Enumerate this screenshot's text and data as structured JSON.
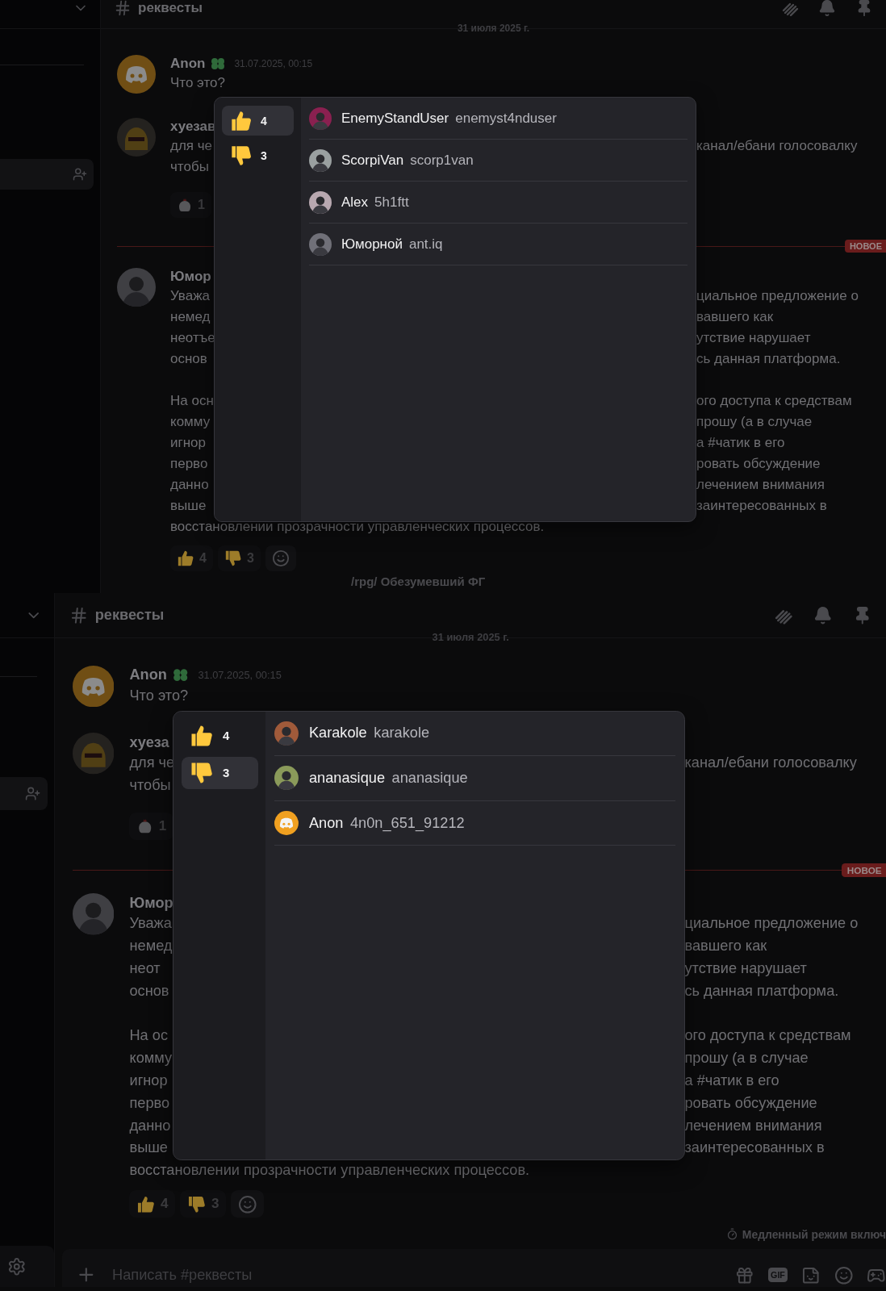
{
  "screens": [
    {
      "channel": "реквесты",
      "date_divider": "31 июля 2025 г.",
      "messages": [
        {
          "kind": "message",
          "author": "Anon",
          "badge": {
            "kind": "clover"
          },
          "timestamp": "31.07.2025, 00:15",
          "avatar": {
            "kind": "default"
          },
          "paragraphs": [
            [
              {
                "left": "Что это?"
              }
            ]
          ]
        },
        {
          "kind": "message",
          "author": "хуезав",
          "avatar": {
            "kind": "helmet"
          },
          "paragraphs": [
            [
              {
                "left": "для че",
                "right": "канал/ебани голосовалку"
              },
              {
                "left": "чтобы"
              }
            ]
          ],
          "reactions": [
            {
              "kind": "chicken",
              "count": "1"
            }
          ]
        },
        {
          "kind": "new-divider",
          "label": "НОВОЕ"
        },
        {
          "kind": "message",
          "author": "Юмор",
          "avatar": {
            "kind": "photo"
          },
          "paragraphs": [
            [
              {
                "left": "Уважа",
                "right": "циальное предложение о"
              },
              {
                "left": "немед",
                "right": "вавшего как"
              },
              {
                "left": "неотъе",
                "right": "утствие нарушает"
              },
              {
                "left": "основ",
                "right": "сь данная платформа."
              }
            ],
            [
              {
                "left": "На осн",
                "right": "ого доступа к средствам"
              },
              {
                "left": "комму",
                "right": "прошу (а в случае"
              },
              {
                "left": "игнор",
                "right": "а #чатик в его"
              },
              {
                "left": "перво",
                "right": "ровать обсуждение"
              },
              {
                "left": "данно",
                "right": "лечением внимания"
              },
              {
                "left": "выше",
                "right": "заинтересованных в"
              },
              {
                "left": "восстановлении прозрачности управленческих процессов."
              }
            ]
          ],
          "reactions": [
            {
              "kind": "thumbs-up",
              "count": "4"
            },
            {
              "kind": "thumbs-down",
              "count": "3"
            }
          ]
        }
      ],
      "popup": {
        "tabs": [
          {
            "kind": "thumbs-up",
            "count": "4",
            "selected": true
          },
          {
            "kind": "thumbs-down",
            "count": "3",
            "selected": false
          }
        ],
        "users": [
          {
            "display_name": "EnemyStandUser",
            "username": "enemyst4nduser",
            "avatar": {
              "kind": "photo",
              "color": "#8a2050"
            }
          },
          {
            "display_name": "ScorpiVan",
            "username": "scorp1van",
            "avatar": {
              "kind": "photo",
              "color": "#9aa0a0"
            }
          },
          {
            "display_name": "Alex",
            "username": "5h1ftt",
            "avatar": {
              "kind": "photo",
              "color": "#b8a8b0"
            }
          },
          {
            "display_name": "Юморной",
            "username": "ant.iq",
            "avatar": {
              "kind": "photo",
              "color": "#707078"
            }
          }
        ]
      },
      "trailing_preview": "/rpg/ Обезумевший ФГ"
    },
    {
      "channel": "реквесты",
      "date_divider": "31 июля 2025 г.",
      "messages": [
        {
          "kind": "message",
          "author": "Anon",
          "badge": {
            "kind": "clover"
          },
          "timestamp": "31.07.2025, 00:15",
          "avatar": {
            "kind": "default"
          },
          "paragraphs": [
            [
              {
                "left": "Что это?"
              }
            ]
          ]
        },
        {
          "kind": "message",
          "author": "хуеза",
          "avatar": {
            "kind": "helmet"
          },
          "paragraphs": [
            [
              {
                "left": "для че",
                "right": "канал/ебани голосовалку"
              },
              {
                "left": "чтобы"
              }
            ]
          ],
          "reactions": [
            {
              "kind": "chicken",
              "count": "1"
            }
          ]
        },
        {
          "kind": "new-divider",
          "label": "НОВОЕ"
        },
        {
          "kind": "message",
          "author": "Юмор",
          "avatar": {
            "kind": "photo"
          },
          "paragraphs": [
            [
              {
                "left": "Уважа",
                "right": "циальное предложение о"
              },
              {
                "left": "немед",
                "right": "вавшего как"
              },
              {
                "left": "неот",
                "right": "утствие нарушает"
              },
              {
                "left": "основ",
                "right": "сь данная платформа."
              }
            ],
            [
              {
                "left": "На ос",
                "right": "ого доступа к средствам"
              },
              {
                "left": "комму",
                "right": "прошу (а в случае"
              },
              {
                "left": "игнор",
                "right": "а #чатик в его"
              },
              {
                "left": "перво",
                "right": "ровать обсуждение"
              },
              {
                "left": "данно",
                "right": "лечением внимания"
              },
              {
                "left": "выше",
                "right": "заинтересованных в"
              },
              {
                "left": "восстановлении прозрачности управленческих процессов."
              }
            ]
          ],
          "reactions": [
            {
              "kind": "thumbs-up",
              "count": "4"
            },
            {
              "kind": "thumbs-down",
              "count": "3"
            }
          ]
        }
      ],
      "popup": {
        "tabs": [
          {
            "kind": "thumbs-up",
            "count": "4",
            "selected": false
          },
          {
            "kind": "thumbs-down",
            "count": "3",
            "selected": true
          }
        ],
        "users": [
          {
            "display_name": "Karakole",
            "username": "karakole",
            "avatar": {
              "kind": "photo",
              "color": "#a05a3a"
            }
          },
          {
            "display_name": "ananasique",
            "username": "ananasique",
            "avatar": {
              "kind": "photo",
              "color": "#8a9a5a"
            }
          },
          {
            "display_name": "Anon",
            "username": "4n0n_651_91212",
            "avatar": {
              "kind": "default",
              "color": "#f0a020"
            }
          }
        ]
      },
      "slow_mode": "Медленный режим включ",
      "composer": {
        "placeholder": "Написать #реквесты",
        "gif_label": "GIF"
      }
    }
  ]
}
